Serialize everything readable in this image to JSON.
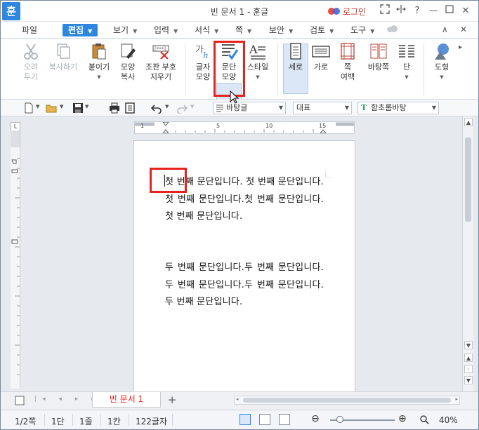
{
  "window": {
    "app_logo": "훈",
    "title": "빈 문서 1 - 훈글",
    "login": "로그인"
  },
  "menu": {
    "items": [
      "파일",
      "편집",
      "보기",
      "입력",
      "서식",
      "쪽",
      "보안",
      "검토",
      "도구"
    ],
    "active": "편집"
  },
  "ribbon": {
    "cut": "오려\n두기",
    "copy": "복사하기",
    "paste": "붙이기",
    "format_copy": "모양\n복사",
    "symbols": "조판 부호\n지우기",
    "char_shape": "글자\n모양",
    "para_shape": "문단\n모양",
    "style": "스타일",
    "portrait": "세로",
    "landscape": "가로",
    "page_margin": "쪽\n여백",
    "background": "바탕쪽",
    "columns": "단",
    "shapes": "도형"
  },
  "toolbar": {
    "style_select": "바탕글",
    "lang_select": "대표",
    "font_select": "함초롬바탕"
  },
  "ruler": {
    "ticks": [
      "1",
      "5",
      "10",
      "15"
    ]
  },
  "document": {
    "para1": "첫 번째 문단입니다. 첫 번째 문단입니다.첫 번째 문단입니다.첫 번째 문단입니다.첫 번째 문단입니다.",
    "para2": "두 번째 문단입니다.두 번째 문단입니다.두 번째 문단입니다.두 번째 문단입니다.두 번째 문단입니다."
  },
  "tabs": {
    "doc_tab": "빈 문서 1",
    "add": "+"
  },
  "status": {
    "page": "1/2쪽",
    "column": "1단",
    "line": "1줄",
    "char_col": "1칸",
    "char_count": "122글자",
    "zoom": "40%"
  },
  "colors": {
    "accent": "#2e86de",
    "highlight": "#e8221f"
  }
}
